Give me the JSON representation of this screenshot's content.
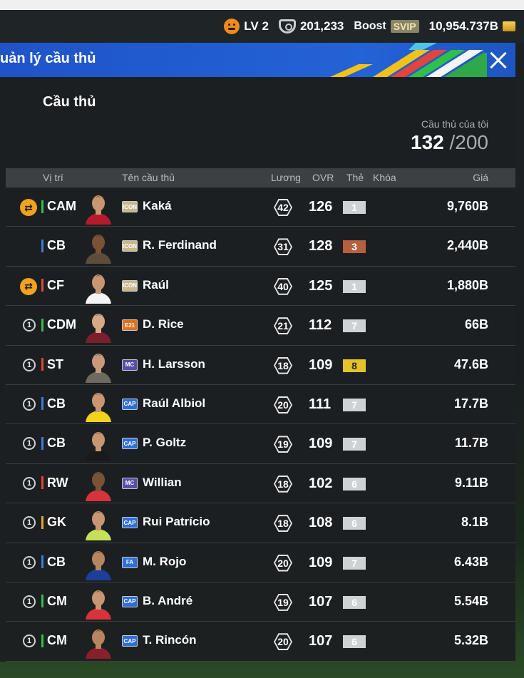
{
  "status": {
    "level": "LV 2",
    "points": "201,233",
    "boost_label": "Boost",
    "svip": "SVIP",
    "balance": "10,954.737B"
  },
  "window": {
    "title": "uản lý cầu thủ"
  },
  "section": {
    "title": "Cầu thủ",
    "count_label": "Cầu thủ của tôi",
    "count": "132",
    "count_max": "/200"
  },
  "table": {
    "headers": {
      "position": "Vị trí",
      "name": "Tên cầu thủ",
      "wage": "Lương",
      "ovr": "OVR",
      "card": "Thẻ",
      "lock": "Khóa",
      "price": "Giá"
    },
    "rows": [
      {
        "tag": "swap",
        "number": "",
        "position": "CAM",
        "pos_color": "#2fbf4a",
        "season": "ICON",
        "season_color": "#c8b98a",
        "name": "Kaká",
        "wage": "42",
        "ovr": "126",
        "grade": "1",
        "grade_bg": "#cfd2d4",
        "grade_fg": "#fff",
        "price": "9,760B",
        "avatar_shirt": "#b51b2a",
        "avatar_skin": "#c99673"
      },
      {
        "tag": "",
        "number": "",
        "position": "CB",
        "pos_color": "#3f7bdf",
        "season": "ICON",
        "season_color": "#c8b98a",
        "name": "R. Ferdinand",
        "wage": "31",
        "ovr": "128",
        "grade": "3",
        "grade_bg": "#b5603e",
        "grade_fg": "#fff",
        "price": "2,440B",
        "avatar_shirt": "#5c4c3a",
        "avatar_skin": "#7a5234"
      },
      {
        "tag": "swap",
        "number": "",
        "position": "CF",
        "pos_color": "#e0463b",
        "season": "ICON",
        "season_color": "#c8b98a",
        "name": "Raúl",
        "wage": "40",
        "ovr": "125",
        "grade": "1",
        "grade_bg": "#cfd2d4",
        "grade_fg": "#fff",
        "price": "1,880B",
        "avatar_shirt": "#f4f4f4",
        "avatar_skin": "#c99673"
      },
      {
        "tag": "",
        "number": "1",
        "position": "CDM",
        "pos_color": "#2fbf4a",
        "season": "E21",
        "season_color": "#e0711f",
        "name": "D. Rice",
        "wage": "21",
        "ovr": "112",
        "grade": "7",
        "grade_bg": "#cfd2d4",
        "grade_fg": "#fff",
        "price": "66B",
        "avatar_shirt": "#7a1f2c",
        "avatar_skin": "#d8a888"
      },
      {
        "tag": "",
        "number": "1",
        "position": "ST",
        "pos_color": "#e0463b",
        "season": "MC",
        "season_color": "#5a4fa8",
        "name": "H. Larsson",
        "wage": "18",
        "ovr": "109",
        "grade": "8",
        "grade_bg": "#e6c22a",
        "grade_fg": "#2a2a2a",
        "price": "47.6B",
        "avatar_shirt": "#6e6a60",
        "avatar_skin": "#c89a7c"
      },
      {
        "tag": "",
        "number": "1",
        "position": "CB",
        "pos_color": "#3f7bdf",
        "season": "CAP",
        "season_color": "#2f6fd6",
        "name": "Raúl Albiol",
        "wage": "20",
        "ovr": "111",
        "grade": "7",
        "grade_bg": "#cfd2d4",
        "grade_fg": "#fff",
        "price": "17.7B",
        "avatar_shirt": "#f2d21b",
        "avatar_skin": "#c99673"
      },
      {
        "tag": "",
        "number": "1",
        "position": "CB",
        "pos_color": "#3f7bdf",
        "season": "CAP",
        "season_color": "#2f6fd6",
        "name": "P. Goltz",
        "wage": "19",
        "ovr": "109",
        "grade": "7",
        "grade_bg": "#cfd2d4",
        "grade_fg": "#fff",
        "price": "11.7B",
        "avatar_shirt": "#1a1a1a",
        "avatar_skin": "#c99673"
      },
      {
        "tag": "",
        "number": "1",
        "position": "RW",
        "pos_color": "#e0463b",
        "season": "MC",
        "season_color": "#5a4fa8",
        "name": "Willian",
        "wage": "18",
        "ovr": "102",
        "grade": "6",
        "grade_bg": "#cfd2d4",
        "grade_fg": "#fff",
        "price": "9.11B",
        "avatar_shirt": "#d8323a",
        "avatar_skin": "#7a5234"
      },
      {
        "tag": "",
        "number": "1",
        "position": "GK",
        "pos_color": "#e6a52a",
        "season": "CAP",
        "season_color": "#2f6fd6",
        "name": "Rui Patrício",
        "wage": "18",
        "ovr": "108",
        "grade": "6",
        "grade_bg": "#cfd2d4",
        "grade_fg": "#fff",
        "price": "8.1B",
        "avatar_shirt": "#c6e05a",
        "avatar_skin": "#c99673"
      },
      {
        "tag": "",
        "number": "1",
        "position": "CB",
        "pos_color": "#3f7bdf",
        "season": "FA",
        "season_color": "#2f6fd6",
        "name": "M. Rojo",
        "wage": "20",
        "ovr": "109",
        "grade": "7",
        "grade_bg": "#cfd2d4",
        "grade_fg": "#fff",
        "price": "6.43B",
        "avatar_shirt": "#1b3f9a",
        "avatar_skin": "#b7855f"
      },
      {
        "tag": "",
        "number": "1",
        "position": "CM",
        "pos_color": "#2fbf4a",
        "season": "CAP",
        "season_color": "#2f6fd6",
        "name": "B. André",
        "wage": "19",
        "ovr": "107",
        "grade": "6",
        "grade_bg": "#cfd2d4",
        "grade_fg": "#fff",
        "price": "5.54B",
        "avatar_shirt": "#d8323a",
        "avatar_skin": "#c99673"
      },
      {
        "tag": "",
        "number": "1",
        "position": "CM",
        "pos_color": "#2fbf4a",
        "season": "CAP",
        "season_color": "#2f6fd6",
        "name": "T. Rincón",
        "wage": "20",
        "ovr": "107",
        "grade": "6",
        "grade_bg": "#cfd2d4",
        "grade_fg": "#fff",
        "price": "5.32B",
        "avatar_shirt": "#8a1f2c",
        "avatar_skin": "#b7855f"
      }
    ]
  }
}
